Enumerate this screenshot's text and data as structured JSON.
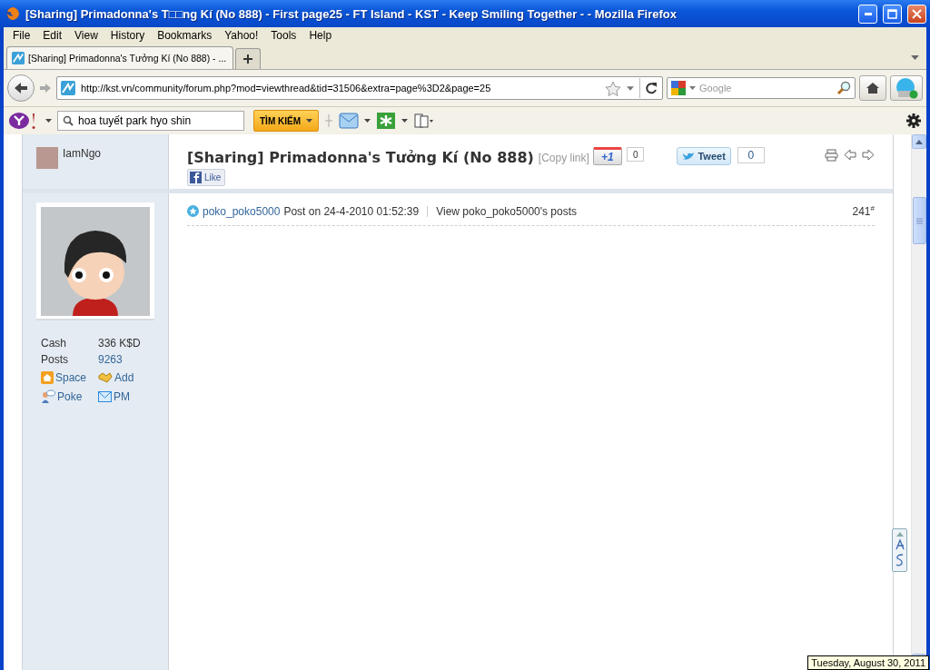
{
  "window": {
    "title": "[Sharing] Primadonna's T□□ng Kí (No 888) - First page25 - FT Island - KST - Keep Smiling Together - - Mozilla Firefox"
  },
  "menu": [
    "File",
    "Edit",
    "View",
    "History",
    "Bookmarks",
    "Yahoo!",
    "Tools",
    "Help"
  ],
  "tabs": [
    {
      "label": "[Sharing] Primadonna's Tưởng Kí (No 888) - ...",
      "selected": true
    }
  ],
  "address_bar": {
    "value": "http://kst.vn/community/forum.php?mod=viewthread&tid=31506&extra=page%3D2&page=25"
  },
  "search_box": {
    "placeholder": "Google"
  },
  "yahoo_toolbar": {
    "search_value": "hoa tuyết park hyo shin",
    "search_button": "TÌM KIẾM"
  },
  "post": {
    "author": "IamNgo",
    "stats": [
      {
        "label": "Cash",
        "value": "336 K$D"
      },
      {
        "label": "Posts",
        "value": "9263"
      }
    ],
    "actions": [
      {
        "kind": "home",
        "label": "Space"
      },
      {
        "kind": "friend",
        "label": "Add"
      },
      {
        "kind": "poke",
        "label": "Poke"
      },
      {
        "kind": "mail",
        "label": "PM"
      }
    ],
    "thread_title": "[Sharing] Primadonna's Tưởng Kí (No 888)",
    "copy_link": "[Copy link]",
    "plusone_label": "+1",
    "plusone_count": "0",
    "tweet_label": "Tweet",
    "tweet_count": "0",
    "like_label": "Like",
    "poster": "poko_poko5000",
    "posted": "Post on 24-4-2010 01:52:39",
    "view_posts": "View poko_poko5000's posts",
    "floor": "241$^{#}$"
  },
  "status_tooltip": "Tuesday, August 30, 2011"
}
